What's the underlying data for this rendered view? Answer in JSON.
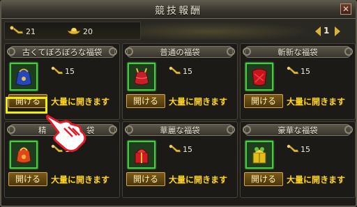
{
  "window": {
    "title": "競技報酬",
    "close_glyph": "✕"
  },
  "resources": [
    {
      "icon": "key-icon",
      "value": "21"
    },
    {
      "icon": "gold-ingot-icon",
      "value": "20"
    }
  ],
  "pager": {
    "page": "1"
  },
  "cards": [
    {
      "title": "古くてぼろぼろな福袋",
      "icon": "blue-bag-icon",
      "cost": "15",
      "open_label": "開ける",
      "bulk_label": "大量に開きます"
    },
    {
      "title": "普通の福袋",
      "icon": "red-bag-icon",
      "cost": "15",
      "open_label": "開ける",
      "bulk_label": "大量に開きます"
    },
    {
      "title": "斬新な福袋",
      "icon": "red-cloth-bag-icon",
      "cost": "15",
      "open_label": "開ける",
      "bulk_label": "大量に開きます"
    },
    {
      "title": "精",
      "icon": "orange-bag-icon",
      "cost": "15",
      "open_label": "開ける",
      "bulk_label": "大量に開きます"
    },
    {
      "title": "華麗な福袋",
      "icon": "red-box-bag-icon",
      "cost": "15",
      "open_label": "開ける",
      "bulk_label": "大量に開きます"
    },
    {
      "title": "豪華な福袋",
      "icon": "gold-box-bag-icon",
      "cost": "15",
      "open_label": "開ける",
      "bulk_label": "大量に開きます"
    }
  ],
  "title_suffix_after_hand": "袋",
  "colors": {
    "accent": "#ffd829",
    "highlight": "#f2f000",
    "item_frame": "#3fcf3a"
  }
}
